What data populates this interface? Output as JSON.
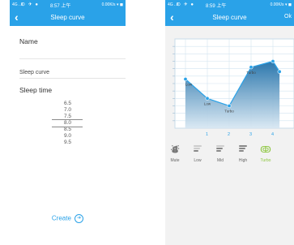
{
  "screen1": {
    "status": {
      "signal": "4G ..ll",
      "icons": "⊙ ✈ ●",
      "time": "8:57 上午",
      "right": "0.00K/s ▾ ◼"
    },
    "nav": {
      "back": "‹",
      "title": "Sleep curve"
    },
    "name_label": "Name",
    "name_value": "Sleep curve",
    "sleep_time_label": "Sleep time",
    "sleep_time_options": [
      "6.5",
      "7.0",
      "7.5",
      "8.0",
      "8.5",
      "9.0",
      "9.5"
    ],
    "sleep_time_selected": "8.0",
    "create_label": "Create",
    "create_icon": "arrow-right-circle-icon"
  },
  "screen2": {
    "status": {
      "signal": "4G ..ll",
      "icons": "⊙ ✈ ●",
      "time": "8:59 上午",
      "right": "0.00K/s ▾ ◼"
    },
    "nav": {
      "back": "‹",
      "title": "Sleep curve",
      "ok": "Ok"
    },
    "chart_data": {
      "type": "area",
      "x": [
        0,
        1,
        2,
        3,
        4,
        4.3
      ],
      "xticks": [
        "1",
        "2",
        "3",
        "4"
      ],
      "values": [
        3.3,
        2.0,
        1.5,
        4.1,
        4.5,
        3.8
      ],
      "point_labels": [
        "Low",
        "Low",
        "Turbo",
        "Turbo",
        "",
        ""
      ],
      "ylim": [
        0,
        6
      ],
      "grid": true,
      "accent": "#2aa2e8"
    },
    "modes": [
      {
        "label": "Mute",
        "icon": "mute-icon",
        "active": false
      },
      {
        "label": "Low",
        "icon": "fan-low-icon",
        "active": false
      },
      {
        "label": "Mid",
        "icon": "fan-mid-icon",
        "active": false
      },
      {
        "label": "High",
        "icon": "fan-high-icon",
        "active": false
      },
      {
        "label": "Turbo",
        "icon": "turbo-icon",
        "active": true
      }
    ]
  }
}
